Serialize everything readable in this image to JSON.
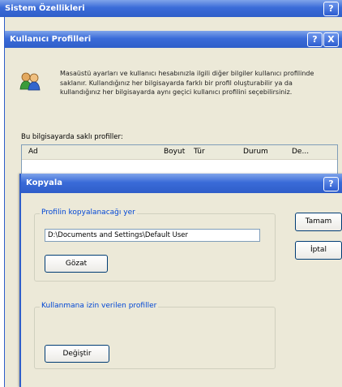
{
  "outer_window": {
    "title": "Sistem Özellikleri",
    "help_button": "?"
  },
  "profiles_window": {
    "title": "Kullanıcı Profilleri",
    "help_button": "?",
    "close_button": "X",
    "description": "Masaüstü ayarları ve kullanıcı hesabınızla ilgili diğer bilgiler kullanıcı profilinde saklanır. Kullandığınız her bilgisayarda farklı bir profil oluşturabilir ya da kullandığınız her bilgisayarda aynı geçici kullanıcı profilini seçebilirsiniz.",
    "list_label": "Bu bilgisayarda saklı profiller:",
    "columns": [
      "Ad",
      "Boyut",
      "Tür",
      "Durum",
      "De..."
    ]
  },
  "copy_dialog": {
    "title": "Kopyala",
    "help_button": "?",
    "target_group_label": "Profilin kopyalanacağı yer",
    "target_path": "D:\\Documents and Settings\\Default User",
    "browse_button": "Gözat",
    "permitted_group_label": "Kullanmana izin verilen profiller",
    "change_button": "Değiştir",
    "ok_button": "Tamam",
    "cancel_button": "İptal"
  },
  "colors": {
    "titlebar": "#2f5ec9",
    "dialog_bg": "#ece9d8",
    "group_label": "#0046d5"
  }
}
